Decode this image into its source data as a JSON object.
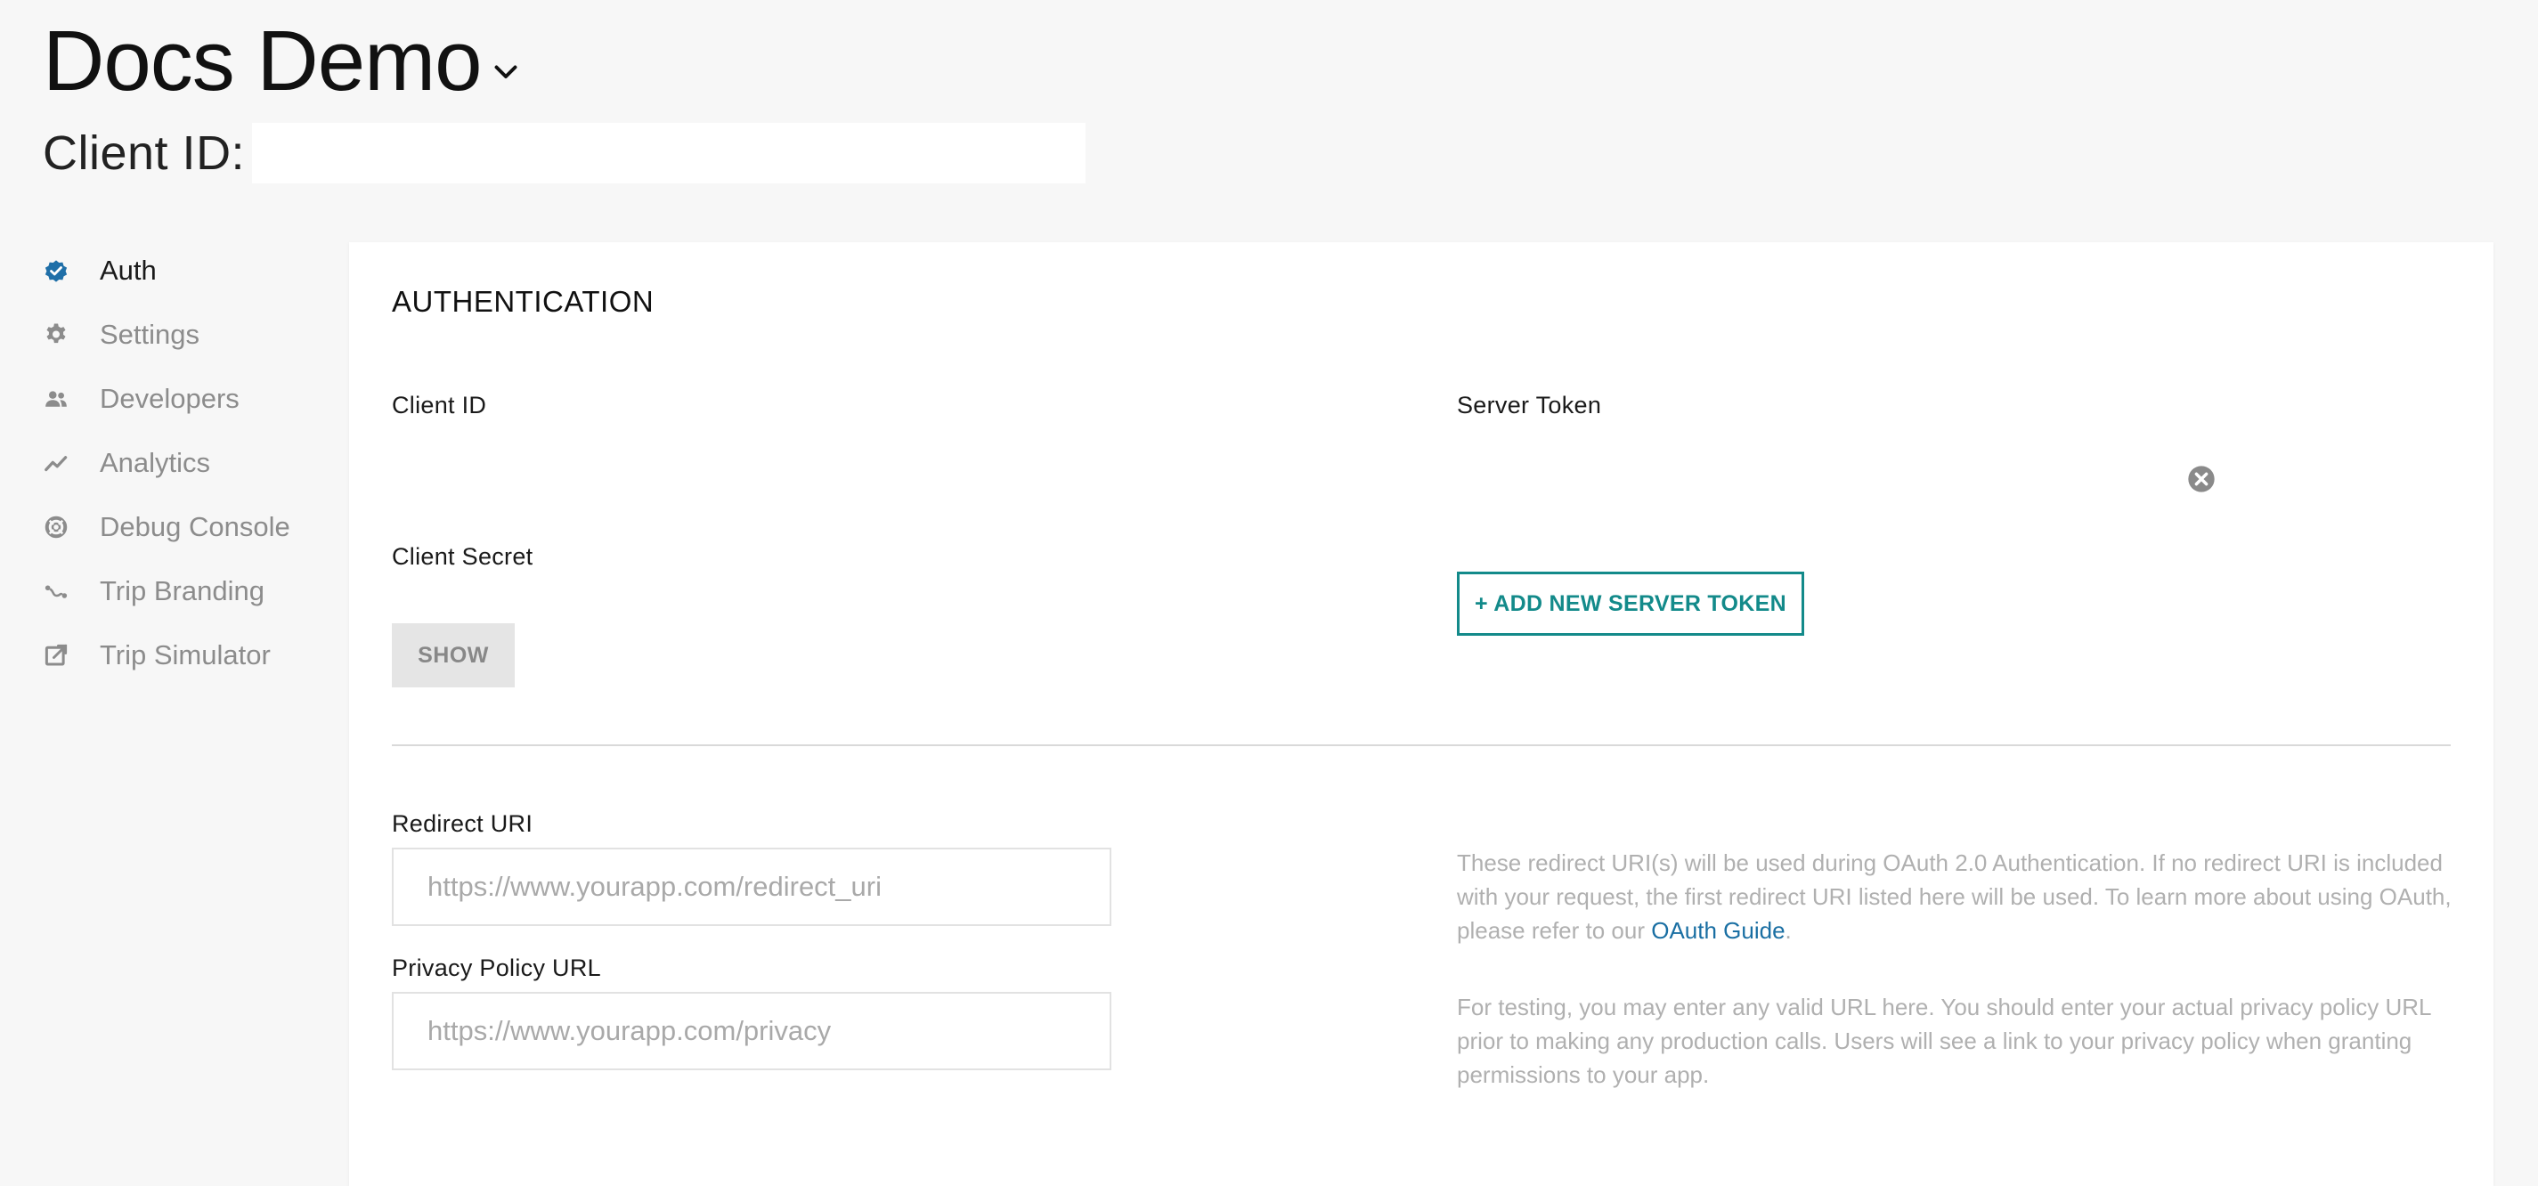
{
  "header": {
    "app_name": "Docs Demo",
    "client_id_label": "Client ID:",
    "client_id_value": ""
  },
  "sidebar": {
    "items": [
      {
        "label": "Auth",
        "icon": "verified-badge-icon",
        "active": true
      },
      {
        "label": "Settings",
        "icon": "gear-icon",
        "active": false
      },
      {
        "label": "Developers",
        "icon": "people-icon",
        "active": false
      },
      {
        "label": "Analytics",
        "icon": "trend-line-icon",
        "active": false
      },
      {
        "label": "Debug Console",
        "icon": "lifebuoy-icon",
        "active": false
      },
      {
        "label": "Trip Branding",
        "icon": "route-icon",
        "active": false
      },
      {
        "label": "Trip Simulator",
        "icon": "external-link-icon",
        "active": false
      }
    ]
  },
  "auth": {
    "section_title": "AUTHENTICATION",
    "client_id_label": "Client ID",
    "server_token_label": "Server Token",
    "client_secret_label": "Client Secret",
    "show_button": "SHOW",
    "add_token_button": "+ ADD NEW SERVER TOKEN",
    "redirect_uri_label": "Redirect URI",
    "redirect_uri_placeholder": "https://www.yourapp.com/redirect_uri",
    "redirect_help_before": "These redirect URI(s) will be used during OAuth 2.0 Authentication. If no redirect URI is included with your request, the first redirect URI listed here will be used. To learn more about using OAuth, please refer to our ",
    "redirect_help_link": "OAuth Guide",
    "redirect_help_after": ".",
    "privacy_label": "Privacy Policy URL",
    "privacy_placeholder": "https://www.yourapp.com/privacy",
    "privacy_help": "For testing, you may enter any valid URL here. You should enter your actual privacy policy URL prior to making any production calls. Users will see a link to your privacy policy when granting permissions to your app."
  },
  "colors": {
    "accent_teal": "#138a8a",
    "active_icon_blue": "#1f6fa8",
    "link_blue": "#1a6fa3",
    "muted_text": "#8c8c8c"
  }
}
